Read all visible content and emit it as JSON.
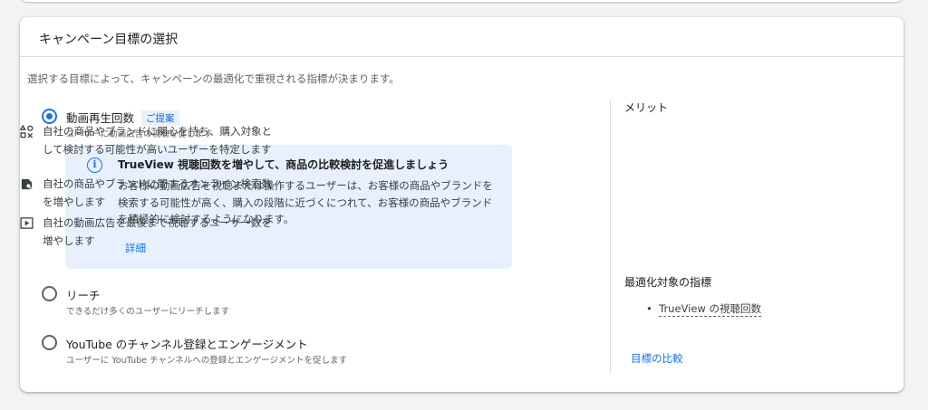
{
  "card": {
    "title": "キャンペーン目標の選択",
    "description": "選択する目標によって、キャンペーンの最適化で重視される指標が決まります。"
  },
  "options": [
    {
      "title": "動画再生回数",
      "badge": "ご提案",
      "subtitle": "ユーザーに動画広告の視聴を促します",
      "selected": true
    },
    {
      "title": "リーチ",
      "subtitle": "できるだけ多くのユーザーにリーチします",
      "selected": false
    },
    {
      "title": "YouTube のチャンネル登録とエンゲージメント",
      "subtitle": "ユーザーに YouTube チャンネルへの登録とエンゲージメントを促します",
      "selected": false
    }
  ],
  "info": {
    "icon": "info-icon",
    "title": "TrueView 視聴回数を増やして、商品の比較検討を促進しましょう",
    "body": "お客様の動画広告を視聴または操作するユーザーは、お客様の商品やブランドを検索する可能性が高く、購入の段階に近づくにつれて、お客様の商品やブランドを積極的に検討するようになります。",
    "link": "詳細"
  },
  "benefits": {
    "heading": "メリット",
    "items": [
      {
        "icon": "shapes-icon",
        "text": "自社の商品やブランドに関心を持ち、購入対象として検討する可能性が高いユーザーを特定します"
      },
      {
        "icon": "search-doc-icon",
        "text": "自社の商品やブランドに関するオンライン検索数を増やします"
      },
      {
        "icon": "play-icon",
        "text": "自社の動画広告を最後まで視聴するユーザー数を増やします"
      }
    ]
  },
  "metrics": {
    "heading": "最適化対象の指標",
    "items": [
      "TrueView の視聴回数"
    ],
    "compare_link": "目標の比較"
  },
  "colors": {
    "accent": "#1a73e8",
    "info_bg": "#e8f0fe"
  }
}
